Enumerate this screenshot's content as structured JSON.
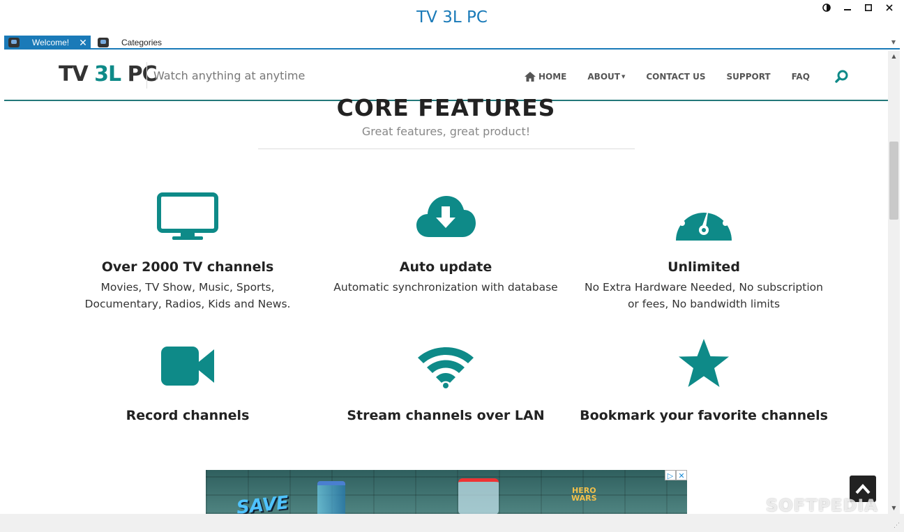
{
  "window": {
    "title": "TV 3L PC",
    "controls": [
      "theme-icon",
      "minimize-icon",
      "maximize-icon",
      "close-icon"
    ]
  },
  "tabs": [
    {
      "label": "Welcome!",
      "active": true
    },
    {
      "label": "Categories",
      "active": false
    }
  ],
  "site": {
    "brand_part1": "TV ",
    "brand_accent": "3L",
    "brand_part2": " PC",
    "tagline": "Watch anything at anytime",
    "accent_color": "#0e8a88",
    "nav": {
      "home": "HOME",
      "about": "ABOUT",
      "contact": "CONTACT US",
      "support": "SUPPORT",
      "faq": "FAQ"
    }
  },
  "section": {
    "title": "CORE FEATURES",
    "subtitle": "Great features, great product!"
  },
  "features": [
    {
      "icon": "tv-icon",
      "title": "Over 2000 TV channels",
      "desc_line1": "Movies, TV Show, Music, Sports,",
      "desc_line2": "Documentary, Radios, Kids and News."
    },
    {
      "icon": "cloud-download-icon",
      "title": "Auto update",
      "desc_line1": "Automatic synchronization with database",
      "desc_line2": ""
    },
    {
      "icon": "dashboard-icon",
      "title": "Unlimited",
      "desc_line1": "No Extra Hardware Needed, No subscription",
      "desc_line2": "or fees, No bandwidth limits"
    },
    {
      "icon": "video-camera-icon",
      "title": "Record channels"
    },
    {
      "icon": "wifi-icon",
      "title": "Stream channels over LAN"
    },
    {
      "icon": "star-icon",
      "title": "Bookmark your favorite channels"
    }
  ],
  "ad": {
    "save_text": "SAVE",
    "logo_line1": "HERO",
    "logo_line2": "WARS"
  },
  "watermark": "SOFTPEDIA"
}
